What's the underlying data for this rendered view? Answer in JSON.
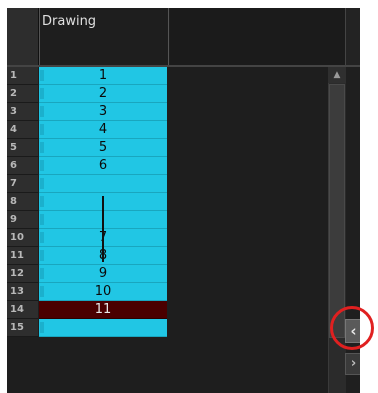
{
  "column": {
    "title": "Drawing"
  },
  "rows": [
    {
      "num": "1",
      "value": "1"
    },
    {
      "num": "2",
      "value": "2"
    },
    {
      "num": "3",
      "value": "3"
    },
    {
      "num": "4",
      "value": "4"
    },
    {
      "num": "5",
      "value": "5"
    },
    {
      "num": "6",
      "value": "6"
    },
    {
      "num": "7",
      "value": ""
    },
    {
      "num": "8",
      "value": ""
    },
    {
      "num": "9",
      "value": ""
    },
    {
      "num": "10",
      "value": "7"
    },
    {
      "num": "11",
      "value": "8"
    },
    {
      "num": "12",
      "value": "9"
    },
    {
      "num": "13",
      "value": "10"
    },
    {
      "num": "14",
      "value": "11"
    },
    {
      "num": "15",
      "value": ""
    }
  ],
  "selected_row": "14",
  "icons": {
    "scroll_up": "▲",
    "collapse": "‹",
    "expand": "›"
  },
  "colors": {
    "cell": "#21c6e4",
    "selected_cell": "#4a0000",
    "highlight_circle": "#e02020"
  }
}
